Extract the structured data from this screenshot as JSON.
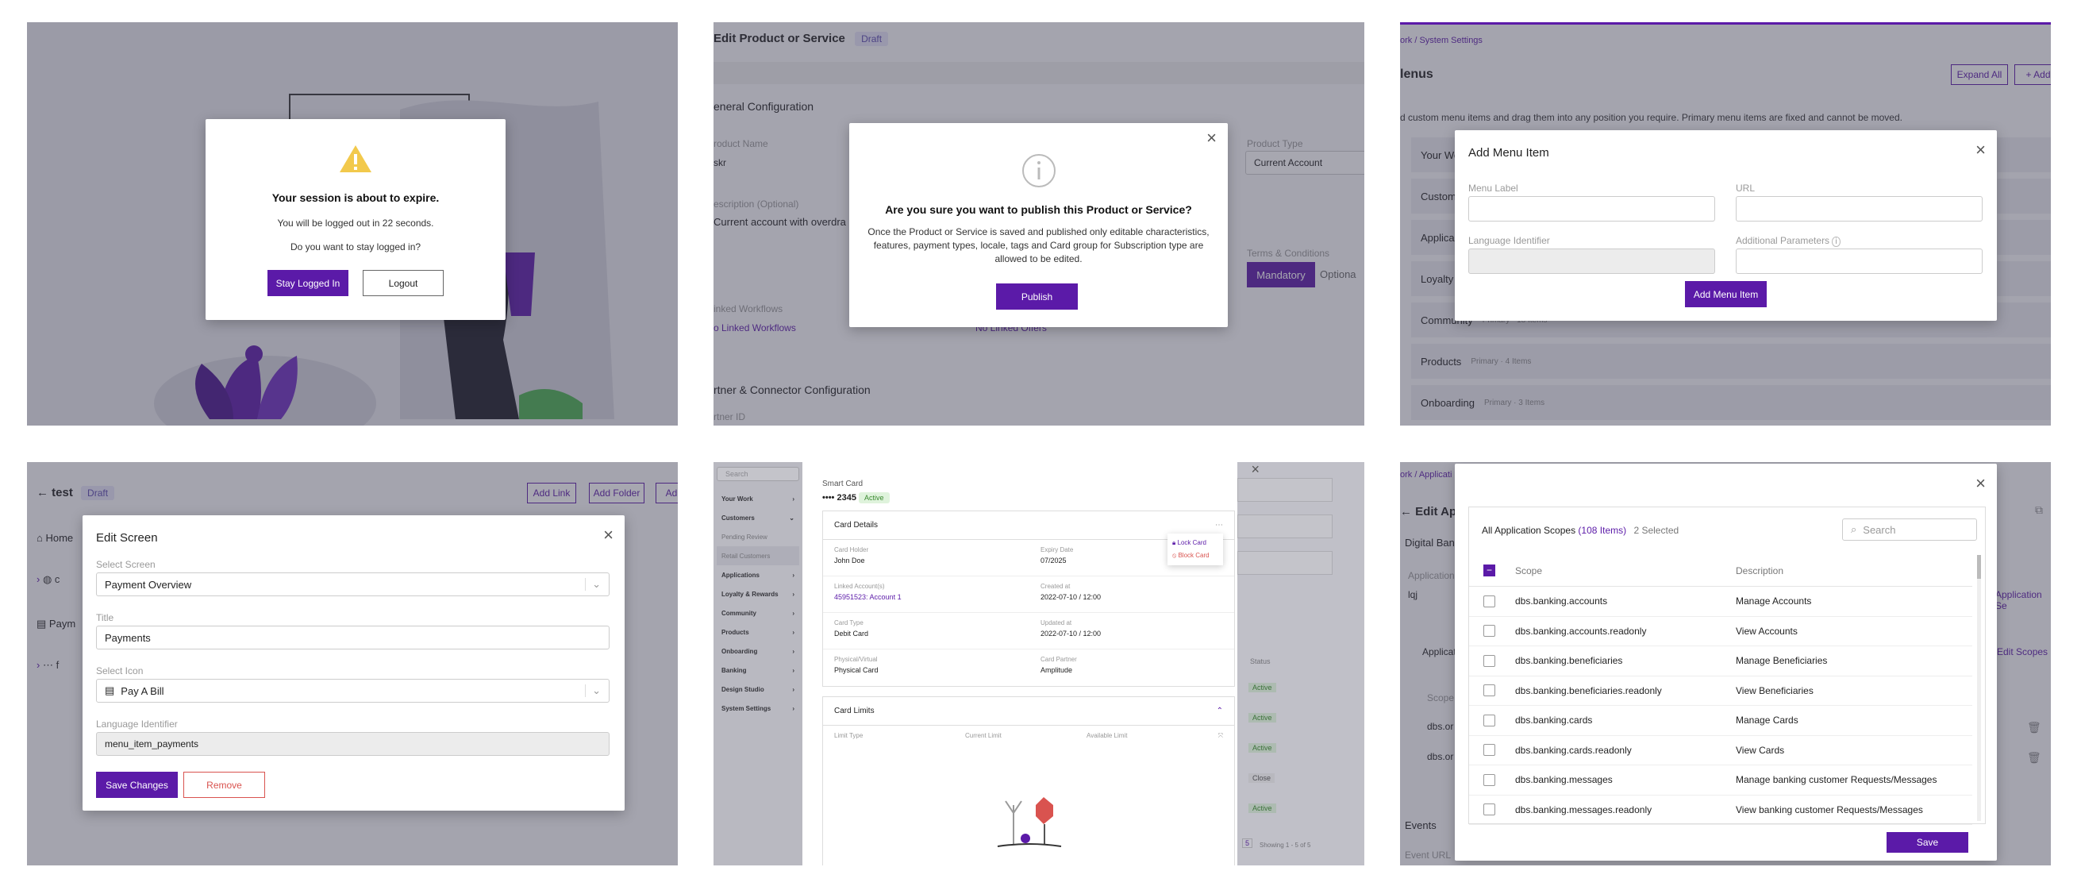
{
  "p1": {
    "title": "Your session is about to expire.",
    "line1": "You will be logged out in 22 seconds.",
    "line2": "Do you want to stay logged in?",
    "stay": "Stay Logged In",
    "logout": "Logout"
  },
  "p2": {
    "page_title": "Edit Product or Service",
    "badge": "Draft",
    "general": "eneral Configuration",
    "product_name_lbl": "roduct Name",
    "product_name_val": "skr",
    "desc_lbl": "escription (Optional)",
    "desc_val": "Current account with overdra",
    "product_type_lbl": "Product Type",
    "product_type_val": "Current Account",
    "terms_lbl": "Terms & Conditions",
    "mandatory": "Mandatory",
    "optional": "Optiona",
    "workflows_lbl": "inked Workflows",
    "workflows_val": "o Linked Workflows",
    "offers_val": "No Linked Offers",
    "partner": "rtner & Connector Configuration",
    "partner_id": "rtner ID",
    "modal_title": "Are you sure you want to publish this Product or Service?",
    "modal_body": "Once the Product or Service is saved and published only editable characteristics, features, payment types, locale, tags and Card group for Subscription type are allowed to be edited.",
    "publish": "Publish"
  },
  "p3": {
    "breadcrumb": "ork / System Settings",
    "heading": "lenus",
    "expand": "Expand All",
    "add": "+ Add",
    "desc": "d custom menu items and drag them into any position you require. Primary menu items are fixed and cannot be moved.",
    "rows": [
      {
        "name": "Your Wo",
        "meta": ""
      },
      {
        "name": "Custom",
        "meta": ""
      },
      {
        "name": "Applica",
        "meta": ""
      },
      {
        "name": "Loyalty",
        "meta": ""
      },
      {
        "name": "Community",
        "meta": "Primary · 18 Items"
      },
      {
        "name": "Products",
        "meta": "Primary · 4 Items"
      },
      {
        "name": "Onboarding",
        "meta": "Primary · 3 Items"
      }
    ],
    "modal_title": "Add Menu Item",
    "menu_label": "Menu Label",
    "url": "URL",
    "lang": "Language Identifier",
    "params": "Additional Parameters",
    "btn": "Add Menu Item"
  },
  "p4": {
    "title": "test",
    "badge": "Draft",
    "add_link": "Add Link",
    "add_folder": "Add Folder",
    "add_more": "Ad",
    "home": "Home",
    "row2": "c",
    "row3": "Paym",
    "row4": "f",
    "modal_title": "Edit Screen",
    "screen_lbl": "Select Screen",
    "screen_val": "Payment Overview",
    "title_lbl": "Title",
    "title_val": "Payments",
    "icon_lbl": "Select Icon",
    "icon_val": "Pay A Bill",
    "lang_lbl": "Language Identifier",
    "lang_val": "menu_item_payments",
    "save": "Save Changes",
    "remove": "Remove"
  },
  "p5": {
    "search": "Search",
    "nav": [
      {
        "label": "Your Work",
        "chev": "›"
      },
      {
        "label": "Customers",
        "chev": "⌄"
      },
      {
        "label": "Pending Review",
        "chev": ""
      },
      {
        "label": "Retail Customers",
        "chev": ""
      },
      {
        "label": "Applications",
        "chev": "›"
      },
      {
        "label": "Loyalty & Rewards",
        "chev": "›"
      },
      {
        "label": "Community",
        "chev": "›"
      },
      {
        "label": "Products",
        "chev": "›"
      },
      {
        "label": "Onboarding",
        "chev": "›"
      },
      {
        "label": "Banking",
        "chev": "›"
      },
      {
        "label": "Design Studio",
        "chev": "›"
      },
      {
        "label": "System Settings",
        "chev": "›"
      }
    ],
    "card_type_title": "Smart Card",
    "card_num": "•••• 2345",
    "status": "Active",
    "details": "Card Details",
    "lock": "Lock Card",
    "block": "Block Card",
    "fields": [
      {
        "l": "Card Holder",
        "v": "John Doe"
      },
      {
        "l": "Expiry Date",
        "v": "07/2025"
      },
      {
        "l": "Linked Account(s)",
        "v": "45951523: Account 1"
      },
      {
        "l": "Created at",
        "v": "2022-07-10 / 12:00"
      },
      {
        "l": "Card Type",
        "v": "Debit Card"
      },
      {
        "l": "Updated at",
        "v": "2022-07-10 / 12:00"
      },
      {
        "l": "Physical/Virtual",
        "v": "Physical Card"
      },
      {
        "l": "Card Partner",
        "v": "Amplitude"
      }
    ],
    "limits": "Card Limits",
    "col1": "Limit Type",
    "col2": "Current Limit",
    "col3": "Available Limit",
    "status_col": "Status",
    "statuses": [
      "Active",
      "Active",
      "Active",
      "Close",
      "Active"
    ],
    "showing": "Showing 1 - 5 of 5",
    "per": "5"
  },
  "p6": {
    "breadcrumb": "ork / Applicati",
    "edit": "Edit App",
    "digital": "Digital Ban",
    "app_lbl": "Application",
    "app_val": "lqj",
    "applic": "Applicat",
    "scope_lbl": "Scope",
    "dbs1": "dbs.or",
    "dbs2": "dbs.or",
    "app_se": "Application Se",
    "edit_scopes": "Edit Scopes",
    "events": "Events",
    "event_url": "Event URL",
    "all": "All Application Scopes",
    "count": "(108 Items)",
    "selected": "2 Selected",
    "search": "Search",
    "col_scope": "Scope",
    "col_desc": "Description",
    "rows": [
      {
        "s": "dbs.banking.accounts",
        "d": "Manage Accounts"
      },
      {
        "s": "dbs.banking.accounts.readonly",
        "d": "View Accounts"
      },
      {
        "s": "dbs.banking.beneficiaries",
        "d": "Manage Beneficiaries"
      },
      {
        "s": "dbs.banking.beneficiaries.readonly",
        "d": "View Beneficiaries"
      },
      {
        "s": "dbs.banking.cards",
        "d": "Manage Cards"
      },
      {
        "s": "dbs.banking.cards.readonly",
        "d": "View Cards"
      },
      {
        "s": "dbs.banking.messages",
        "d": "Manage banking customer Requests/Messages"
      },
      {
        "s": "dbs.banking.messages.readonly",
        "d": "View banking customer Requests/Messages"
      }
    ],
    "save": "Save"
  },
  "colors": {
    "primary": "#5b1aa8",
    "warning": "#f2c94c",
    "danger": "#d9534f",
    "success": "#3a8a30"
  }
}
